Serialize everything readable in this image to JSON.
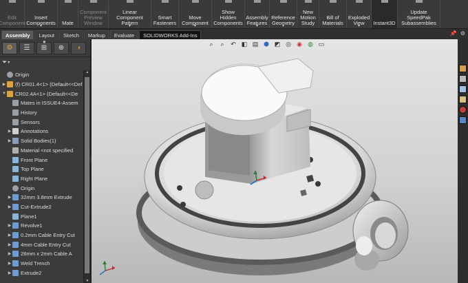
{
  "ribbon": {
    "buttons": [
      {
        "name": "edit-component-button",
        "label": "Edit\nComponent",
        "disabled": true,
        "width": 36
      },
      {
        "name": "insert-components-button",
        "label": "Insert\nComponents",
        "disabled": false,
        "width": 48,
        "caret": true
      },
      {
        "name": "mate-button",
        "label": "Mate",
        "disabled": false,
        "width": 30
      },
      {
        "name": "component-preview-window-button",
        "label": "Component\nPreview\nWindow",
        "disabled": true,
        "width": 44
      },
      {
        "name": "linear-component-pattern-button",
        "label": "Linear Component\nPattern",
        "disabled": false,
        "width": 62,
        "caret": true
      },
      {
        "name": "smart-fasteners-button",
        "label": "Smart\nFasteners",
        "disabled": false,
        "width": 40
      },
      {
        "name": "move-component-button",
        "label": "Move\nComponent",
        "disabled": false,
        "width": 48,
        "caret": true
      },
      {
        "name": "show-hidden-components-button",
        "label": "Show\nHidden\nComponents",
        "disabled": false,
        "width": 48
      },
      {
        "name": "assembly-features-button",
        "label": "Assembly\nFeatures",
        "disabled": false,
        "width": 36,
        "caret": true
      },
      {
        "name": "reference-geometry-button",
        "label": "Reference\nGeometry",
        "disabled": false,
        "width": 40,
        "caret": true
      },
      {
        "name": "new-motion-study-button",
        "label": "New\nMotion\nStudy",
        "disabled": false,
        "width": 32
      },
      {
        "name": "bill-of-materials-button",
        "label": "Bill of\nMaterials",
        "disabled": false,
        "width": 40
      },
      {
        "name": "exploded-view-button",
        "label": "Exploded\nView",
        "disabled": false,
        "width": 36,
        "caret": true
      },
      {
        "name": "instant3d-button",
        "label": "Instant3D",
        "disabled": false,
        "width": 38,
        "active": true
      },
      {
        "name": "update-speedpak-button",
        "label": "Update\nSpeedPak\nSubassemblies",
        "disabled": false,
        "width": 62
      }
    ]
  },
  "tabs": [
    {
      "label": "Assembly",
      "active": true
    },
    {
      "label": "Layout"
    },
    {
      "label": "Sketch"
    },
    {
      "label": "Markup"
    },
    {
      "label": "Evaluate"
    },
    {
      "label": "SOLIDWORKS Add-Ins",
      "black": true
    }
  ],
  "tree": [
    {
      "label": "Origin",
      "indent": 0,
      "arrow": "",
      "icon": "origin-icon",
      "color": "#9aa0a6"
    },
    {
      "label": "(f) CR01.4<1> (Default<<Def",
      "indent": 0,
      "arrow": "▶",
      "icon": "part-icon",
      "color": "#d9a441"
    },
    {
      "label": "CR02.4A<1> (Default<<De",
      "indent": 0,
      "arrow": "▼",
      "icon": "part-icon",
      "color": "#d9a441"
    },
    {
      "label": "Mates in ISSUE4-Assem",
      "indent": 1,
      "arrow": "",
      "icon": "mates-icon",
      "color": "#9aa0a6"
    },
    {
      "label": "History",
      "indent": 1,
      "arrow": "",
      "icon": "history-icon",
      "color": "#9aa0a6"
    },
    {
      "label": "Sensors",
      "indent": 1,
      "arrow": "",
      "icon": "sensor-icon",
      "color": "#9aa0a6"
    },
    {
      "label": "Annotations",
      "indent": 1,
      "arrow": "▶",
      "icon": "annotation-icon",
      "color": "#cfcfcf"
    },
    {
      "label": "Solid Bodies(1)",
      "indent": 1,
      "arrow": "▶",
      "icon": "solid-bodies-icon",
      "color": "#8aa0b8"
    },
    {
      "label": "Material <not specified",
      "indent": 1,
      "arrow": "",
      "icon": "material-icon",
      "color": "#b0b0b0"
    },
    {
      "label": "Front Plane",
      "indent": 1,
      "arrow": "",
      "icon": "plane-icon",
      "color": "#8ab4d8"
    },
    {
      "label": "Top Plane",
      "indent": 1,
      "arrow": "",
      "icon": "plane-icon",
      "color": "#8ab4d8"
    },
    {
      "label": "Right Plane",
      "indent": 1,
      "arrow": "",
      "icon": "plane-icon",
      "color": "#8ab4d8"
    },
    {
      "label": "Origin",
      "indent": 1,
      "arrow": "",
      "icon": "origin-icon",
      "color": "#9aa0a6"
    },
    {
      "label": "32mm 3.8mm Extrude",
      "indent": 1,
      "arrow": "▶",
      "icon": "extrude-icon",
      "color": "#6f9bd0"
    },
    {
      "label": "Cut-Extrude2",
      "indent": 1,
      "arrow": "▶",
      "icon": "cut-extrude-icon",
      "color": "#6f9bd0"
    },
    {
      "label": "Plane1",
      "indent": 1,
      "arrow": "",
      "icon": "plane-icon",
      "color": "#8ab4d8"
    },
    {
      "label": "Revolve1",
      "indent": 1,
      "arrow": "▶",
      "icon": "revolve-icon",
      "color": "#6f9bd0"
    },
    {
      "label": "0.2mm Cable Entry Cut",
      "indent": 1,
      "arrow": "▶",
      "icon": "cut-extrude-icon",
      "color": "#6f9bd0"
    },
    {
      "label": "4mm Cable Entry Cut",
      "indent": 1,
      "arrow": "▶",
      "icon": "cut-extrude-icon",
      "color": "#6f9bd0"
    },
    {
      "label": "28mm x 2mm Cable A",
      "indent": 1,
      "arrow": "▶",
      "icon": "cut-extrude-icon",
      "color": "#6f9bd0"
    },
    {
      "label": "Weld Trench",
      "indent": 1,
      "arrow": "▶",
      "icon": "cut-extrude-icon",
      "color": "#6f9bd0"
    },
    {
      "label": "Extrude2",
      "indent": 1,
      "arrow": "▶",
      "icon": "extrude-icon",
      "color": "#6f9bd0"
    }
  ]
}
